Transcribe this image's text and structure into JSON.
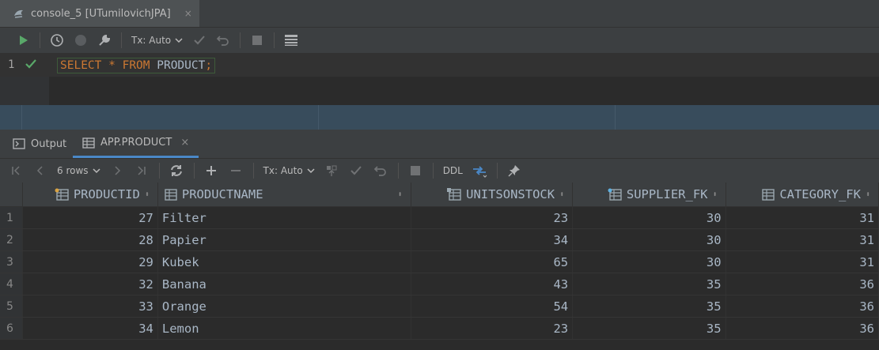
{
  "editor_tab": {
    "title": "console_5 [UTumilovichJPA]",
    "close": "×"
  },
  "toolbar": {
    "tx_mode": "Tx: Auto"
  },
  "editor": {
    "line_number": "1",
    "tokens": [
      {
        "text": "SELECT",
        "kind": "kw"
      },
      {
        "text": " ",
        "kind": "id"
      },
      {
        "text": "*",
        "kind": "kw"
      },
      {
        "text": " ",
        "kind": "id"
      },
      {
        "text": "FROM",
        "kind": "kw"
      },
      {
        "text": " PRODUCT",
        "kind": "id"
      },
      {
        "text": ";",
        "kind": "kw"
      }
    ]
  },
  "result_tabs": {
    "output": "Output",
    "table": "APP.PRODUCT",
    "close": "×"
  },
  "grid_toolbar": {
    "rows": "6 rows",
    "tx_mode": "Tx: Auto",
    "ddl": "DDL"
  },
  "table": {
    "columns": [
      "PRODUCTID",
      "PRODUCTNAME",
      "UNITSONSTOCK",
      "SUPPLIER_FK",
      "CATEGORY_FK"
    ],
    "rows": [
      {
        "n": "1",
        "PRODUCTID": "27",
        "PRODUCTNAME": "Filter",
        "UNITSONSTOCK": "23",
        "SUPPLIER_FK": "30",
        "CATEGORY_FK": "31"
      },
      {
        "n": "2",
        "PRODUCTID": "28",
        "PRODUCTNAME": "Papier",
        "UNITSONSTOCK": "34",
        "SUPPLIER_FK": "30",
        "CATEGORY_FK": "31"
      },
      {
        "n": "3",
        "PRODUCTID": "29",
        "PRODUCTNAME": "Kubek",
        "UNITSONSTOCK": "65",
        "SUPPLIER_FK": "30",
        "CATEGORY_FK": "31"
      },
      {
        "n": "4",
        "PRODUCTID": "32",
        "PRODUCTNAME": "Banana",
        "UNITSONSTOCK": "43",
        "SUPPLIER_FK": "35",
        "CATEGORY_FK": "36"
      },
      {
        "n": "5",
        "PRODUCTID": "33",
        "PRODUCTNAME": "Orange",
        "UNITSONSTOCK": "54",
        "SUPPLIER_FK": "35",
        "CATEGORY_FK": "36"
      },
      {
        "n": "6",
        "PRODUCTID": "34",
        "PRODUCTNAME": "Lemon",
        "UNITSONSTOCK": "23",
        "SUPPLIER_FK": "35",
        "CATEGORY_FK": "36"
      }
    ]
  },
  "colors": {
    "accent": "#4a88c7",
    "keyword": "#cc7832",
    "run": "#59a869",
    "background": "#2b2b2b"
  }
}
